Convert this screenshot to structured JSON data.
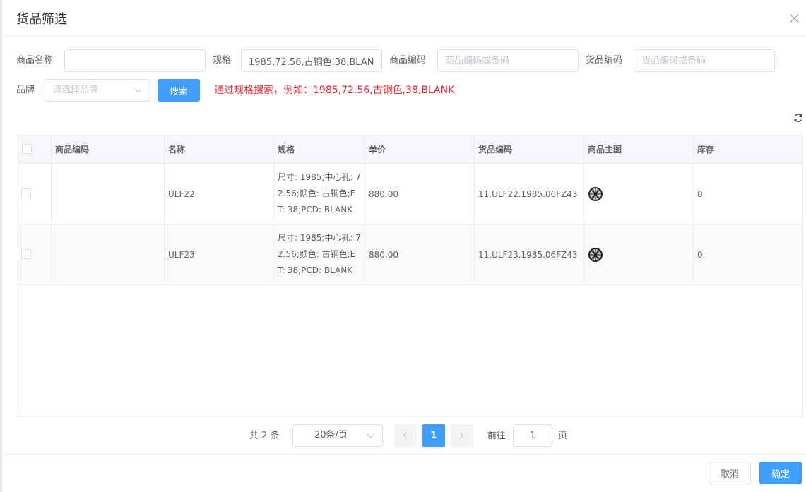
{
  "dialog": {
    "title": "货品筛选"
  },
  "filters": {
    "name_label": "商品名称",
    "name_value": "",
    "spec_label": "规格",
    "spec_value": "1985,72.56,古铜色,38,BLANK",
    "product_code_label": "商品编码",
    "product_code_placeholder": "商品编码或条码",
    "goods_code_label": "货品编码",
    "goods_code_placeholder": "货品编码或条码",
    "brand_label": "品牌",
    "brand_placeholder": "请选择品牌",
    "search_label": "搜索",
    "hint": "通过规格搜索，例如：1985,72.56,古铜色,38,BLANK"
  },
  "table": {
    "headers": {
      "product_code": "商品编码",
      "name": "名称",
      "spec": "规格",
      "price": "单价",
      "goods_code": "货品编码",
      "image": "商品主图",
      "stock": "库存"
    },
    "rows": [
      {
        "product_code": "",
        "name": "ULF22",
        "spec": "尺寸: 1985;中心孔: 72.56;颜色: 古铜色;ET: 38;PCD: BLANK",
        "price": "880.00",
        "goods_code": "11.ULF22.1985.06FZ43",
        "image": "wheel-icon",
        "stock": "0"
      },
      {
        "product_code": "",
        "name": "ULF23",
        "spec": "尺寸: 1985;中心孔: 72.56;颜色: 古铜色;ET: 38;PCD: BLANK",
        "price": "880.00",
        "goods_code": "11.ULF23.1985.06FZ43",
        "image": "wheel-icon",
        "stock": "0"
      }
    ]
  },
  "pagination": {
    "total": "共 2 条",
    "page_size": "20条/页",
    "current_page": "1",
    "goto_label": "前往",
    "goto_value": "1",
    "page_unit": "页"
  },
  "footer": {
    "cancel_label": "取消",
    "confirm_label": "确定"
  },
  "colors": {
    "primary": "#409eff",
    "hint": "#f5222d",
    "border": "#dcdfe6"
  }
}
